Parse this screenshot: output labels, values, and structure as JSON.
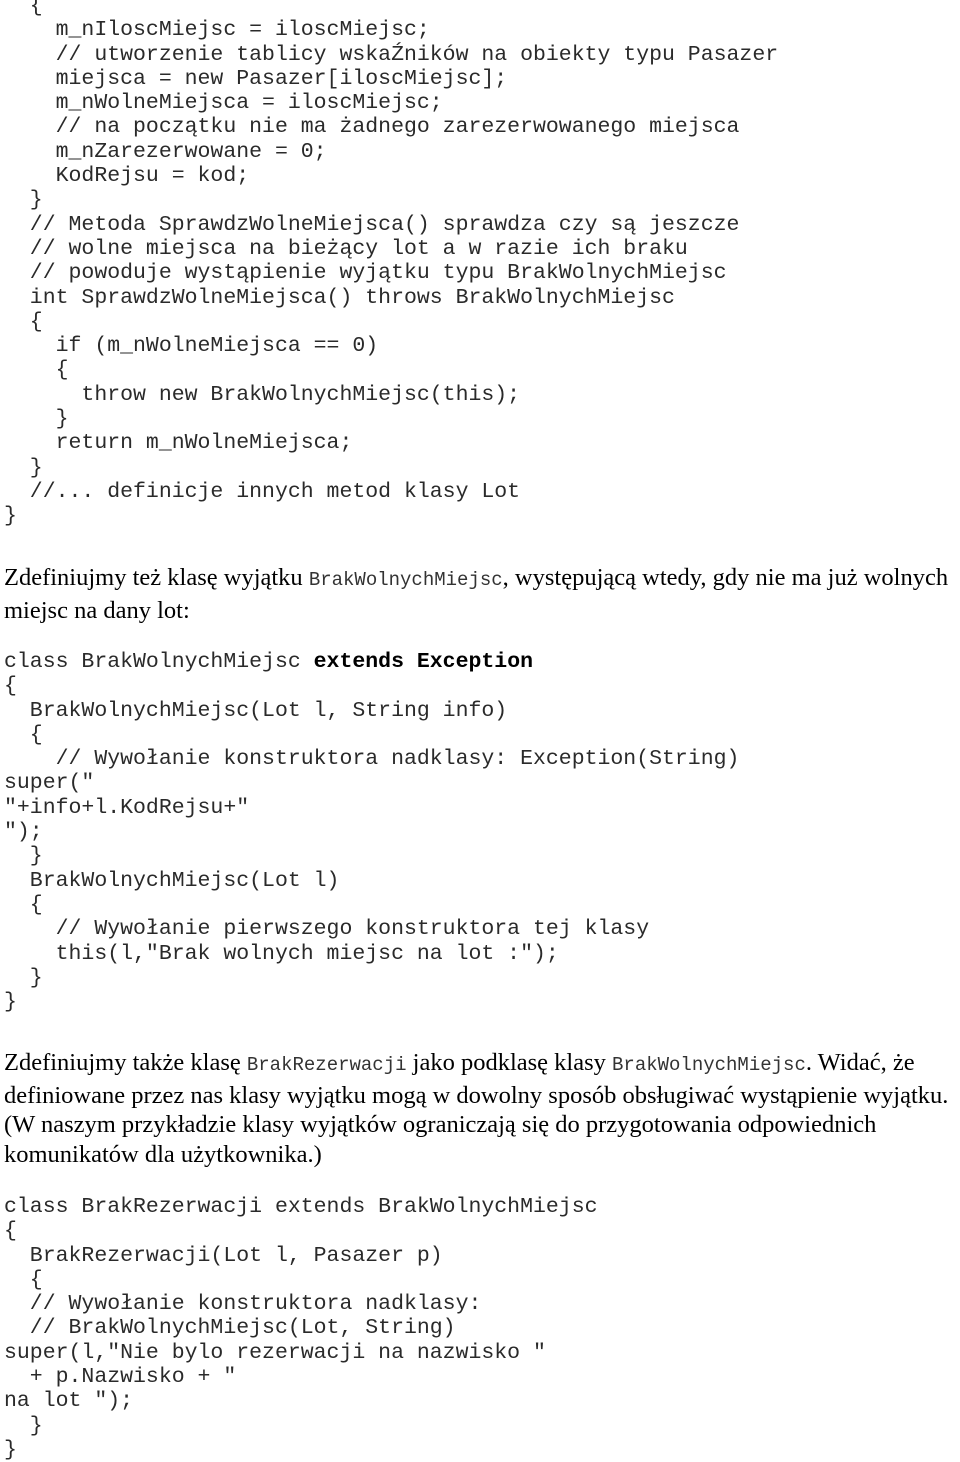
{
  "code_block_1": {
    "lines": [
      "  {",
      "    m_nIloscMiejsc = iloscMiejsc;",
      "    // utworzenie tablicy wskaŹników na obiekty typu Pasazer",
      "    miejsca = new Pasazer[iloscMiejsc];",
      "    m_nWolneMiejsca = iloscMiejsc;",
      "    // na początku nie ma żadnego zarezerwowanego miejsca",
      "    m_nZarezerwowane = 0;",
      "    KodRejsu = kod;",
      "  }",
      "  // Metoda SprawdzWolneMiejsca() sprawdza czy są jeszcze",
      "  // wolne miejsca na bieżący lot a w razie ich braku",
      "  // powoduje wystąpienie wyjątku typu BrakWolnychMiejsc",
      "  int SprawdzWolneMiejsca() throws BrakWolnychMiejsc",
      "  {",
      "    if (m_nWolneMiejsca == 0)",
      "    {",
      "      throw new BrakWolnychMiejsc(this);",
      "    }",
      "    return m_nWolneMiejsca;",
      "  }",
      "  //... definicje innych metod klasy Lot",
      "}"
    ]
  },
  "paragraph_1": {
    "text_before": "Zdefiniujmy też klasę wyjątku ",
    "code_ref": "BrakWolnychMiejsc",
    "text_after": ", występującą wtedy, gdy nie ma już wolnych miejsc na dany lot:"
  },
  "code_block_2": {
    "class_line": {
      "prefix": "class BrakWolnychMiejsc ",
      "keyword": "extends Exception"
    },
    "lines": [
      "{",
      "  BrakWolnychMiejsc(Lot l, String info)",
      "  {",
      "    // Wywołanie konstruktora nadklasy: Exception(String)",
      "super(\"",
      "\"+info+l.KodRejsu+\"",
      "\");",
      "  }",
      "  BrakWolnychMiejsc(Lot l)",
      "  {",
      "    // Wywołanie pierwszego konstruktora tej klasy",
      "    this(l,\"Brak wolnych miejsc na lot :\");",
      "  }",
      "}"
    ]
  },
  "paragraph_2": {
    "text_1": "Zdefiniujmy także klasę ",
    "code_ref_1": "BrakRezerwacji",
    "text_2": " jako podklasę klasy ",
    "code_ref_2": "BrakWolnychMiejsc",
    "text_3": ". Widać, że definiowane przez nas klasy wyjątku mogą w dowolny sposób obsługiwać wystąpienie wyjątku. (W naszym przykładzie klasy wyjątków ograniczają się do przygotowania odpowiednich komunikatów dla użytkownika.)"
  },
  "code_block_3": {
    "lines": [
      "class BrakRezerwacji extends BrakWolnychMiejsc",
      "{",
      "  BrakRezerwacji(Lot l, Pasazer p)",
      "  {",
      "  // Wywołanie konstruktora nadklasy:",
      "  // BrakWolnychMiejsc(Lot, String)",
      "super(l,\"Nie bylo rezerwacji na nazwisko \"",
      "  + p.Nazwisko + \"",
      "na lot \");",
      "  }",
      "}"
    ]
  }
}
